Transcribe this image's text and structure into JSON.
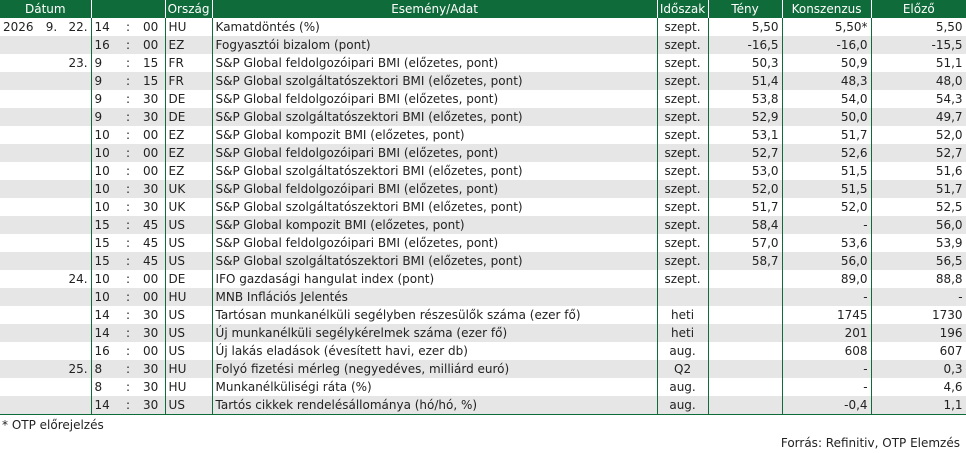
{
  "headers": {
    "date": "Dátum",
    "country": "Ország",
    "event": "Esemény/Adat",
    "period": "Időszak",
    "actual": "Tény",
    "consensus": "Konszenzus",
    "previous": "Előző"
  },
  "rows": [
    {
      "year": "2026",
      "month": "9.",
      "day": "22.",
      "hh": "14",
      "sep": ":",
      "mm": "00",
      "country": "HU",
      "event": "Kamatdöntés (%)",
      "period": "szept.",
      "actual": "5,50",
      "consensus": "5,50*",
      "previous": "5,50"
    },
    {
      "year": "",
      "month": "",
      "day": "",
      "hh": "16",
      "sep": ":",
      "mm": "00",
      "country": "EZ",
      "event": "Fogyasztói bizalom (pont)",
      "period": "szept.",
      "actual": "-16,5",
      "consensus": "-16,0",
      "previous": "-15,5"
    },
    {
      "year": "",
      "month": "",
      "day": "23.",
      "hh": "9",
      "sep": ":",
      "mm": "15",
      "country": "FR",
      "event": "S&P Global feldolgozóipari BMI (előzetes, pont)",
      "period": "szept.",
      "actual": "50,3",
      "consensus": "50,9",
      "previous": "51,1"
    },
    {
      "year": "",
      "month": "",
      "day": "",
      "hh": "9",
      "sep": ":",
      "mm": "15",
      "country": "FR",
      "event": "S&P Global szolgáltatószektori BMI (előzetes, pont)",
      "period": "szept.",
      "actual": "51,4",
      "consensus": "48,3",
      "previous": "48,0"
    },
    {
      "year": "",
      "month": "",
      "day": "",
      "hh": "9",
      "sep": ":",
      "mm": "30",
      "country": "DE",
      "event": "S&P Global feldolgozóipari BMI (előzetes, pont)",
      "period": "szept.",
      "actual": "53,8",
      "consensus": "54,0",
      "previous": "54,3"
    },
    {
      "year": "",
      "month": "",
      "day": "",
      "hh": "9",
      "sep": ":",
      "mm": "30",
      "country": "DE",
      "event": "S&P Global szolgáltatószektori BMI (előzetes, pont)",
      "period": "szept.",
      "actual": "52,9",
      "consensus": "50,0",
      "previous": "49,7"
    },
    {
      "year": "",
      "month": "",
      "day": "",
      "hh": "10",
      "sep": ":",
      "mm": "00",
      "country": "EZ",
      "event": "S&P Global kompozit BMI (előzetes, pont)",
      "period": "szept.",
      "actual": "53,1",
      "consensus": "51,7",
      "previous": "52,0"
    },
    {
      "year": "",
      "month": "",
      "day": "",
      "hh": "10",
      "sep": ":",
      "mm": "00",
      "country": "EZ",
      "event": "S&P Global feldolgozóipari BMI (előzetes, pont)",
      "period": "szept.",
      "actual": "52,7",
      "consensus": "52,6",
      "previous": "52,7"
    },
    {
      "year": "",
      "month": "",
      "day": "",
      "hh": "10",
      "sep": ":",
      "mm": "00",
      "country": "EZ",
      "event": "S&P Global szolgáltatószektori BMI (előzetes, pont)",
      "period": "szept.",
      "actual": "53,0",
      "consensus": "51,5",
      "previous": "51,6"
    },
    {
      "year": "",
      "month": "",
      "day": "",
      "hh": "10",
      "sep": ":",
      "mm": "30",
      "country": "UK",
      "event": "S&P Global feldolgozóipari BMI (előzetes, pont)",
      "period": "szept.",
      "actual": "52,0",
      "consensus": "51,5",
      "previous": "51,7"
    },
    {
      "year": "",
      "month": "",
      "day": "",
      "hh": "10",
      "sep": ":",
      "mm": "30",
      "country": "UK",
      "event": "S&P Global szolgáltatószektori BMI (előzetes, pont)",
      "period": "szept.",
      "actual": "51,7",
      "consensus": "52,0",
      "previous": "52,5"
    },
    {
      "year": "",
      "month": "",
      "day": "",
      "hh": "15",
      "sep": ":",
      "mm": "45",
      "country": "US",
      "event": "S&P Global kompozit BMI (előzetes, pont)",
      "period": "szept.",
      "actual": "58,4",
      "consensus": "-",
      "previous": "56,0"
    },
    {
      "year": "",
      "month": "",
      "day": "",
      "hh": "15",
      "sep": ":",
      "mm": "45",
      "country": "US",
      "event": "S&P Global feldolgozóipari BMI (előzetes, pont)",
      "period": "szept.",
      "actual": "57,0",
      "consensus": "53,6",
      "previous": "53,9"
    },
    {
      "year": "",
      "month": "",
      "day": "",
      "hh": "15",
      "sep": ":",
      "mm": "45",
      "country": "US",
      "event": "S&P Global szolgáltatószektori BMI (előzetes, pont)",
      "period": "szept.",
      "actual": "58,7",
      "consensus": "56,0",
      "previous": "56,5"
    },
    {
      "year": "",
      "month": "",
      "day": "24.",
      "hh": "10",
      "sep": ":",
      "mm": "00",
      "country": "DE",
      "event": "IFO gazdasági hangulat index (pont)",
      "period": "szept.",
      "actual": "",
      "consensus": "89,0",
      "previous": "88,8"
    },
    {
      "year": "",
      "month": "",
      "day": "",
      "hh": "10",
      "sep": ":",
      "mm": "00",
      "country": "HU",
      "event": "MNB Inflációs Jelentés",
      "period": "",
      "actual": "",
      "consensus": "-",
      "previous": "-"
    },
    {
      "year": "",
      "month": "",
      "day": "",
      "hh": "14",
      "sep": ":",
      "mm": "30",
      "country": "US",
      "event": "Tartósan munkanélküli segélyben részesülők száma (ezer fő)",
      "period": "heti",
      "actual": "",
      "consensus": "1745",
      "previous": "1730"
    },
    {
      "year": "",
      "month": "",
      "day": "",
      "hh": "14",
      "sep": ":",
      "mm": "30",
      "country": "US",
      "event": "Új munkanélküli segélykérelmek száma (ezer fő)",
      "period": "heti",
      "actual": "",
      "consensus": "201",
      "previous": "196"
    },
    {
      "year": "",
      "month": "",
      "day": "",
      "hh": "16",
      "sep": ":",
      "mm": "00",
      "country": "US",
      "event": "Új lakás eladások (évesített havi, ezer db)",
      "period": "aug.",
      "actual": "",
      "consensus": "608",
      "previous": "607"
    },
    {
      "year": "",
      "month": "",
      "day": "25.",
      "hh": "8",
      "sep": ":",
      "mm": "30",
      "country": "HU",
      "event": "Folyó fizetési mérleg (negyedéves, milliárd euró)",
      "period": "Q2",
      "actual": "",
      "consensus": "-",
      "previous": "0,3"
    },
    {
      "year": "",
      "month": "",
      "day": "",
      "hh": "8",
      "sep": ":",
      "mm": "30",
      "country": "HU",
      "event": "Munkanélküliségi ráta (%)",
      "period": "aug.",
      "actual": "",
      "consensus": "-",
      "previous": "4,6"
    },
    {
      "year": "",
      "month": "",
      "day": "",
      "hh": "14",
      "sep": ":",
      "mm": "30",
      "country": "US",
      "event": "Tartós cikkek rendelésállománya (hó/hó, %)",
      "period": "aug.",
      "actual": "",
      "consensus": "-0,4",
      "previous": "1,1"
    }
  ],
  "footnote": "* OTP előrejelzés",
  "source": "Forrás: Refinitiv, OTP Elemzés"
}
